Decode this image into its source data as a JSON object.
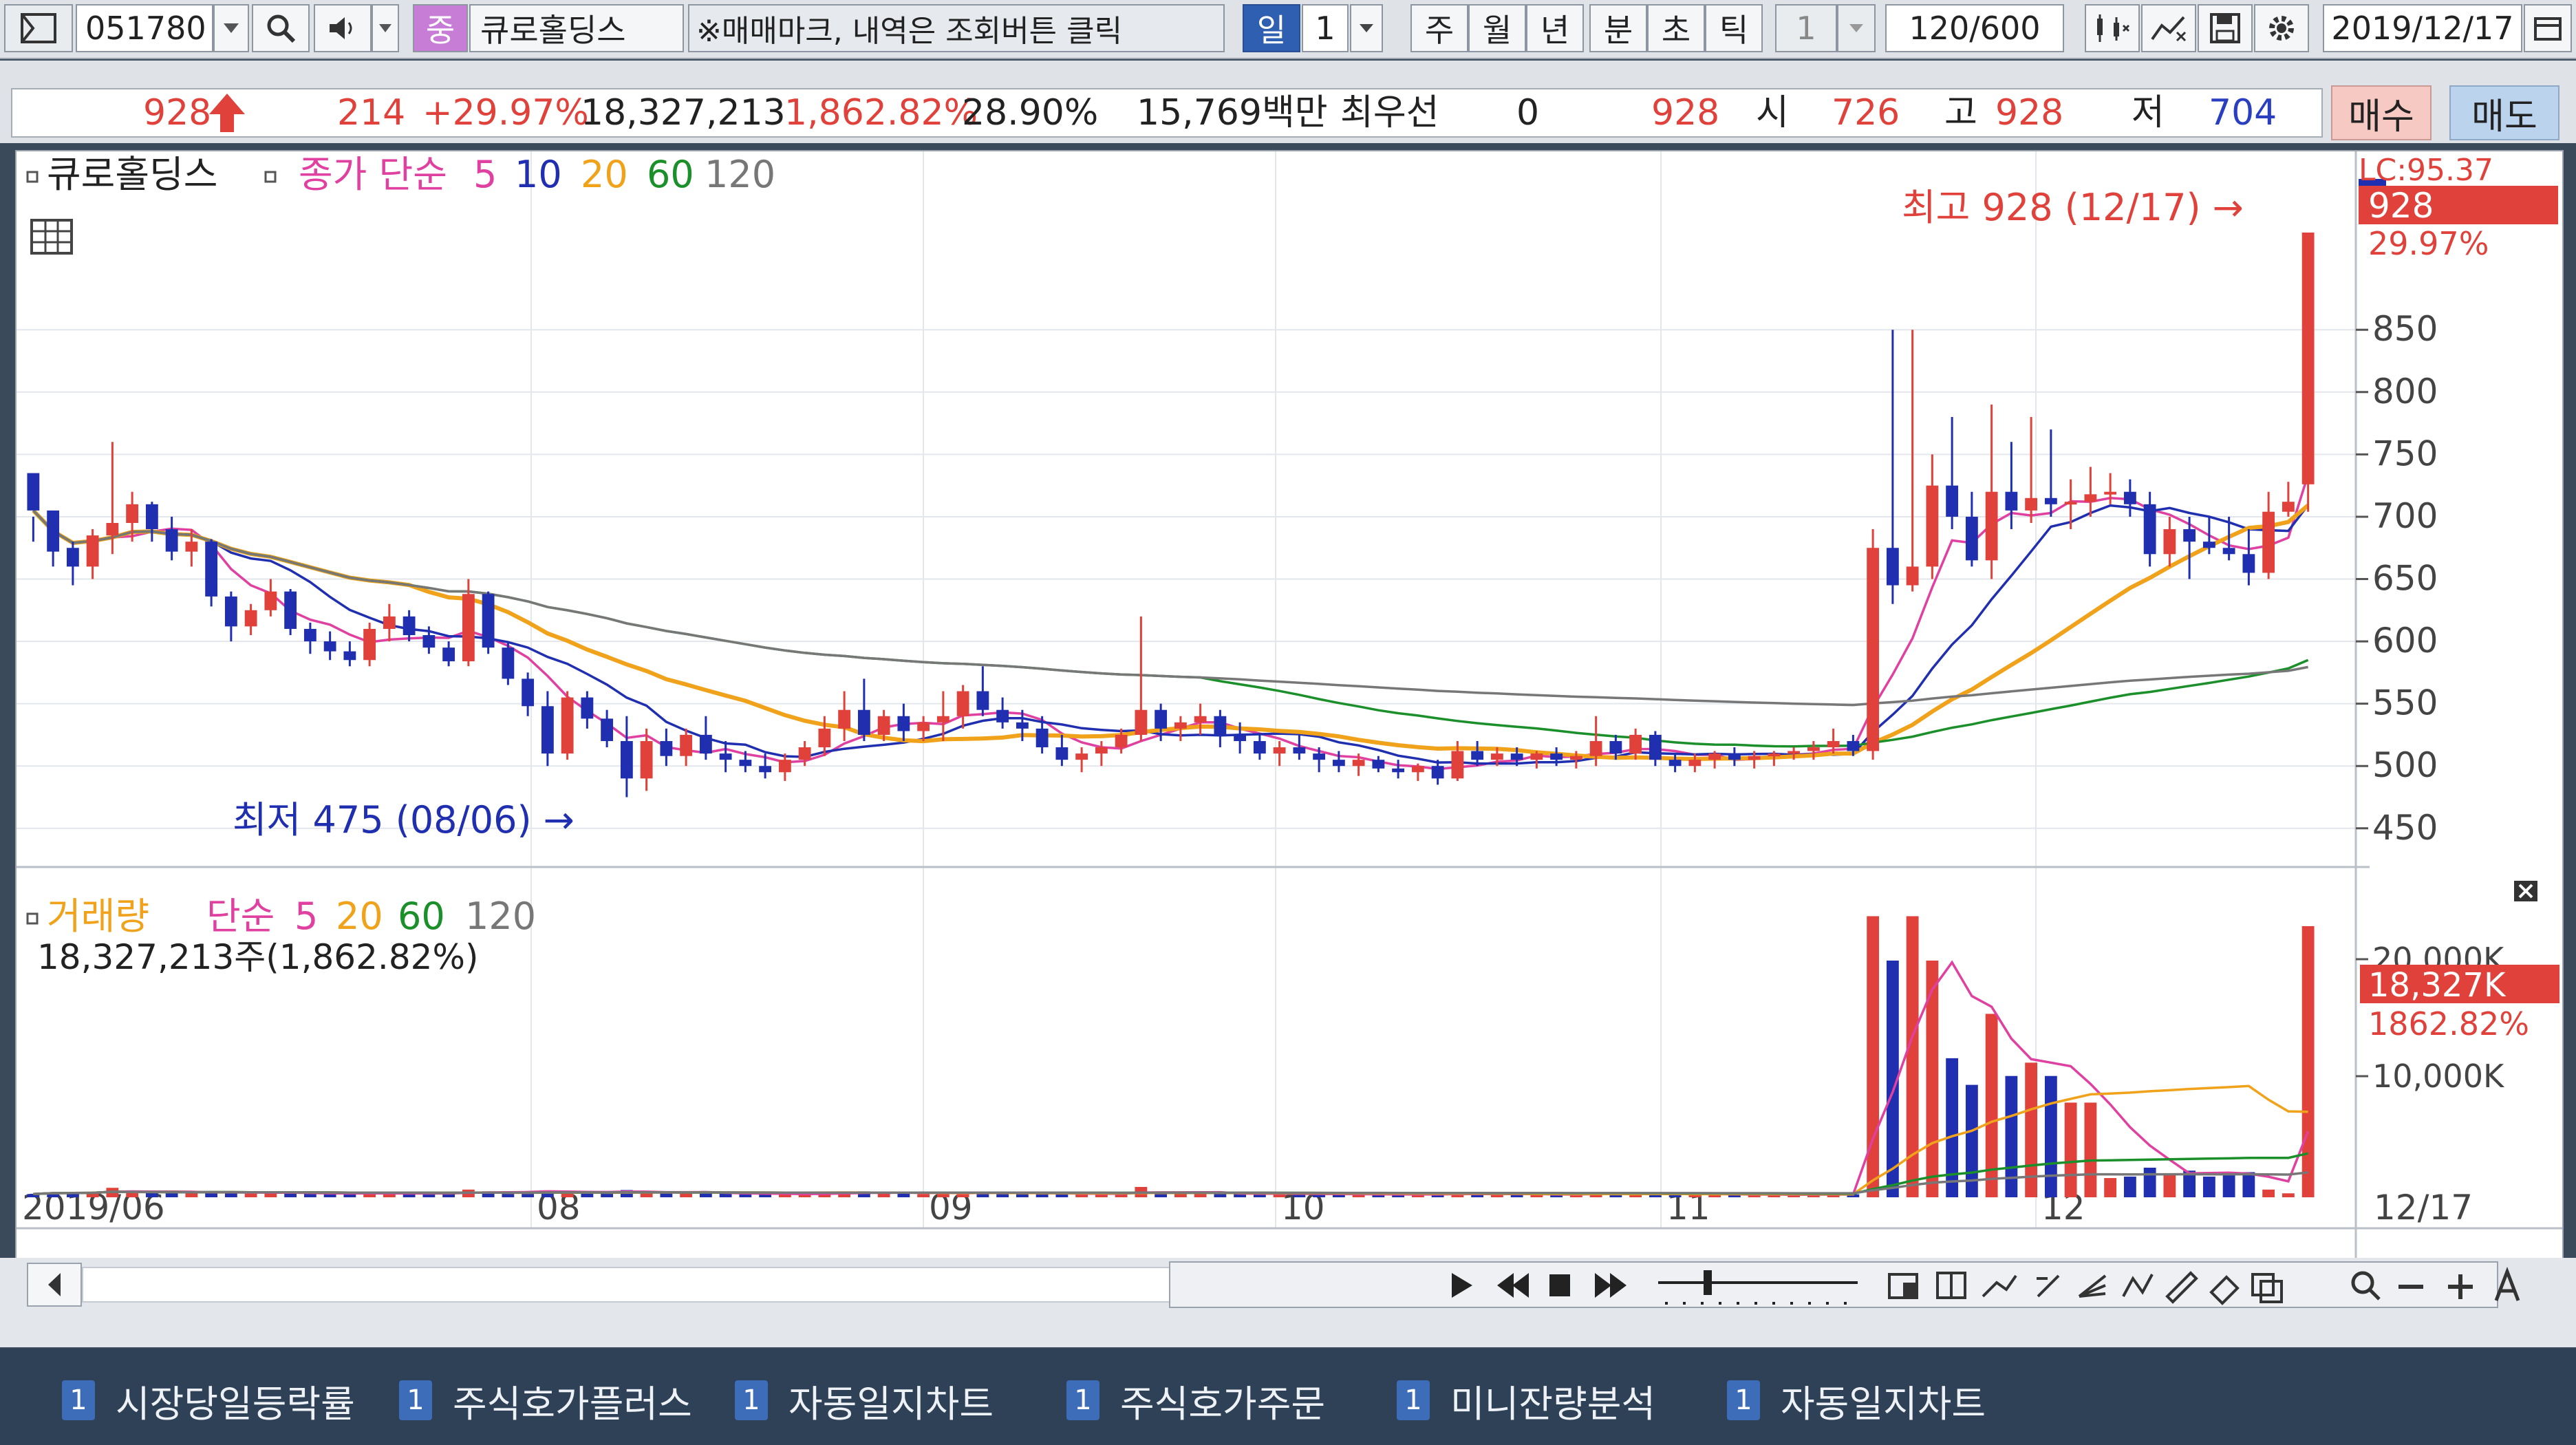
{
  "toolbar": {
    "code": "051780",
    "name": "큐로홀딩스",
    "name_badge": "중",
    "notice": "※매매마크, 내역은 조회버튼 클릭",
    "period_selected": "일",
    "period_value": "1",
    "periods": [
      "주",
      "월",
      "년",
      "분",
      "초",
      "틱"
    ],
    "tick_value": "1",
    "count": "120/600",
    "date": "2019/12/17"
  },
  "quote": {
    "price": "928",
    "change": "214",
    "change_pct": "+29.97%",
    "volume": "18,327,213",
    "volume_ratio": "1,862.82%",
    "turnover": "28.90%",
    "amount": "15,769백만",
    "best_label": "최우선",
    "best_value": "0",
    "best_price": "928",
    "open_label": "시",
    "open": "726",
    "high_label": "고",
    "high": "928",
    "low_label": "저",
    "low": "704",
    "buy_button": "매수",
    "sell_button": "매도"
  },
  "price_panel": {
    "legend_name": "큐로홀딩스",
    "legend_series": "종가 단순",
    "ma_periods": [
      "5",
      "10",
      "20",
      "60",
      "120"
    ],
    "high_annotation": "최고 928 (12/17) →",
    "low_annotation": "최저 475 (08/06) →",
    "last_price_tag": "928",
    "last_pct_tag": "29.97%",
    "lc_tag": "LC:95.37"
  },
  "volume_panel": {
    "legend_name": "거래량",
    "legend_series": "단순",
    "ma_periods": [
      "5",
      "20",
      "60",
      "120"
    ],
    "summary": "18,327,213주(1,862.82%)",
    "last_tag": "18,327K",
    "last_pct_tag": "1862.82%"
  },
  "chart_data": {
    "type": "candlestick",
    "price_axis": {
      "ticks": [
        450,
        500,
        550,
        600,
        650,
        700,
        750,
        800,
        850
      ],
      "range": [
        430,
        960
      ]
    },
    "volume_axis": {
      "ticks": [
        "10,000K",
        "20,000K"
      ]
    },
    "x_labels": [
      "2019/06",
      "08",
      "09",
      "10",
      "11",
      "12",
      "12/17"
    ],
    "colors": {
      "up": "#e0413a",
      "down": "#1f2fb0",
      "ma5": "#e040a0",
      "ma10": "#1f2fb0",
      "ma20": "#f0a21a",
      "ma60": "#1a8f2a",
      "ma120": "#777777"
    },
    "candles": [
      [
        735,
        700,
        680,
        705
      ],
      [
        705,
        700,
        660,
        672
      ],
      [
        675,
        680,
        645,
        660
      ],
      [
        660,
        690,
        650,
        685
      ],
      [
        685,
        760,
        670,
        695
      ],
      [
        695,
        720,
        680,
        710
      ],
      [
        710,
        712,
        680,
        690
      ],
      [
        690,
        700,
        665,
        672
      ],
      [
        672,
        690,
        660,
        680
      ],
      [
        680,
        682,
        628,
        636
      ],
      [
        636,
        640,
        600,
        612
      ],
      [
        612,
        630,
        605,
        625
      ],
      [
        625,
        650,
        620,
        640
      ],
      [
        640,
        642,
        605,
        610
      ],
      [
        610,
        615,
        590,
        600
      ],
      [
        600,
        608,
        585,
        592
      ],
      [
        592,
        600,
        580,
        585
      ],
      [
        585,
        615,
        580,
        610
      ],
      [
        610,
        630,
        600,
        620
      ],
      [
        620,
        625,
        600,
        605
      ],
      [
        605,
        612,
        590,
        595
      ],
      [
        595,
        600,
        580,
        584
      ],
      [
        584,
        650,
        580,
        638
      ],
      [
        638,
        640,
        590,
        595
      ],
      [
        595,
        600,
        565,
        570
      ],
      [
        570,
        575,
        540,
        548
      ],
      [
        548,
        560,
        500,
        510
      ],
      [
        510,
        560,
        505,
        555
      ],
      [
        555,
        560,
        530,
        538
      ],
      [
        538,
        545,
        515,
        520
      ],
      [
        520,
        540,
        475,
        490
      ],
      [
        490,
        530,
        480,
        520
      ],
      [
        520,
        530,
        500,
        508
      ],
      [
        508,
        530,
        500,
        525
      ],
      [
        525,
        540,
        505,
        510
      ],
      [
        510,
        520,
        495,
        505
      ],
      [
        505,
        512,
        495,
        500
      ],
      [
        500,
        510,
        490,
        495
      ],
      [
        495,
        510,
        488,
        505
      ],
      [
        505,
        520,
        500,
        515
      ],
      [
        515,
        540,
        508,
        530
      ],
      [
        530,
        560,
        520,
        545
      ],
      [
        545,
        570,
        520,
        525
      ],
      [
        525,
        545,
        520,
        540
      ],
      [
        540,
        550,
        520,
        528
      ],
      [
        528,
        540,
        520,
        535
      ],
      [
        535,
        560,
        520,
        540
      ],
      [
        540,
        565,
        530,
        560
      ],
      [
        560,
        580,
        540,
        545
      ],
      [
        545,
        555,
        530,
        535
      ],
      [
        535,
        545,
        520,
        530
      ],
      [
        530,
        540,
        510,
        515
      ],
      [
        515,
        525,
        500,
        505
      ],
      [
        505,
        515,
        495,
        510
      ],
      [
        510,
        520,
        500,
        515
      ],
      [
        515,
        530,
        510,
        525
      ],
      [
        525,
        620,
        520,
        545
      ],
      [
        545,
        550,
        520,
        530
      ],
      [
        530,
        540,
        520,
        535
      ],
      [
        535,
        550,
        525,
        540
      ],
      [
        540,
        545,
        515,
        525
      ],
      [
        525,
        535,
        510,
        520
      ],
      [
        520,
        525,
        505,
        510
      ],
      [
        510,
        520,
        500,
        515
      ],
      [
        515,
        525,
        505,
        510
      ],
      [
        510,
        515,
        495,
        505
      ],
      [
        505,
        512,
        495,
        500
      ],
      [
        500,
        510,
        492,
        505
      ],
      [
        505,
        508,
        495,
        498
      ],
      [
        498,
        505,
        490,
        495
      ],
      [
        495,
        502,
        488,
        500
      ],
      [
        500,
        505,
        485,
        490
      ],
      [
        490,
        520,
        488,
        512
      ],
      [
        512,
        520,
        500,
        505
      ],
      [
        505,
        515,
        500,
        510
      ],
      [
        510,
        515,
        500,
        505
      ],
      [
        505,
        512,
        498,
        510
      ],
      [
        510,
        515,
        500,
        505
      ],
      [
        505,
        512,
        498,
        508
      ],
      [
        508,
        540,
        500,
        520
      ],
      [
        520,
        525,
        505,
        510
      ],
      [
        510,
        530,
        505,
        525
      ],
      [
        525,
        528,
        500,
        505
      ],
      [
        505,
        510,
        495,
        500
      ],
      [
        500,
        510,
        495,
        505
      ],
      [
        505,
        512,
        498,
        510
      ],
      [
        510,
        515,
        500,
        505
      ],
      [
        505,
        512,
        498,
        508
      ],
      [
        508,
        512,
        500,
        510
      ],
      [
        510,
        515,
        505,
        512
      ],
      [
        512,
        520,
        505,
        515
      ],
      [
        515,
        530,
        510,
        520
      ],
      [
        520,
        525,
        508,
        512
      ],
      [
        512,
        690,
        505,
        675
      ],
      [
        675,
        850,
        630,
        645
      ],
      [
        645,
        850,
        640,
        660
      ],
      [
        660,
        750,
        650,
        725
      ],
      [
        725,
        780,
        690,
        700
      ],
      [
        700,
        720,
        660,
        665
      ],
      [
        665,
        790,
        650,
        720
      ],
      [
        720,
        760,
        690,
        705
      ],
      [
        705,
        780,
        695,
        715
      ],
      [
        715,
        770,
        700,
        710
      ],
      [
        710,
        730,
        690,
        712
      ],
      [
        712,
        740,
        700,
        718
      ],
      [
        718,
        735,
        710,
        720
      ],
      [
        720,
        730,
        700,
        710
      ],
      [
        710,
        720,
        660,
        670
      ],
      [
        670,
        700,
        660,
        690
      ],
      [
        690,
        700,
        650,
        680
      ],
      [
        680,
        700,
        670,
        675
      ],
      [
        675,
        700,
        665,
        670
      ],
      [
        670,
        690,
        645,
        655
      ],
      [
        655,
        720,
        650,
        704
      ],
      [
        704,
        728,
        700,
        712
      ],
      [
        726,
        928,
        704,
        928
      ]
    ]
  }
}
